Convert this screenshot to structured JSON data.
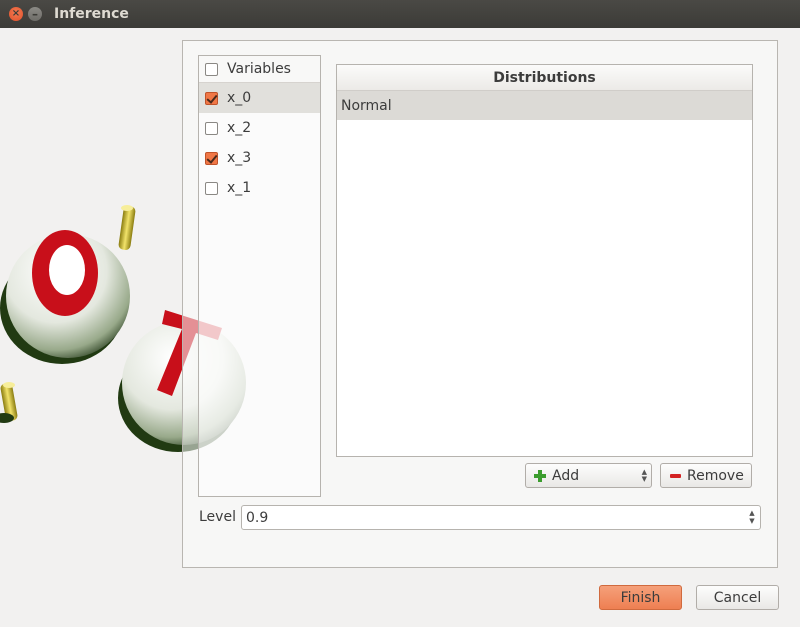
{
  "window": {
    "title": "Inference",
    "close_icon": "close-icon",
    "minimize_icon": "minimize-icon"
  },
  "variables": {
    "header_label": "Variables",
    "header_checked": false,
    "items": [
      {
        "label": "x_0",
        "checked": true,
        "selected": true
      },
      {
        "label": "x_2",
        "checked": false,
        "selected": false
      },
      {
        "label": "x_3",
        "checked": true,
        "selected": false
      },
      {
        "label": "x_1",
        "checked": false,
        "selected": false
      }
    ]
  },
  "distributions": {
    "header": "Distributions",
    "rows": [
      "Normal"
    ]
  },
  "buttons": {
    "add_label": "Add",
    "remove_label": "Remove",
    "finish_label": "Finish",
    "cancel_label": "Cancel"
  },
  "level": {
    "label": "Level",
    "value": "0.9"
  },
  "colors": {
    "accent": "#f07746",
    "titlebar": "#3c3b37",
    "add_icon": "#3c9d2e",
    "remove_icon": "#d32222"
  }
}
